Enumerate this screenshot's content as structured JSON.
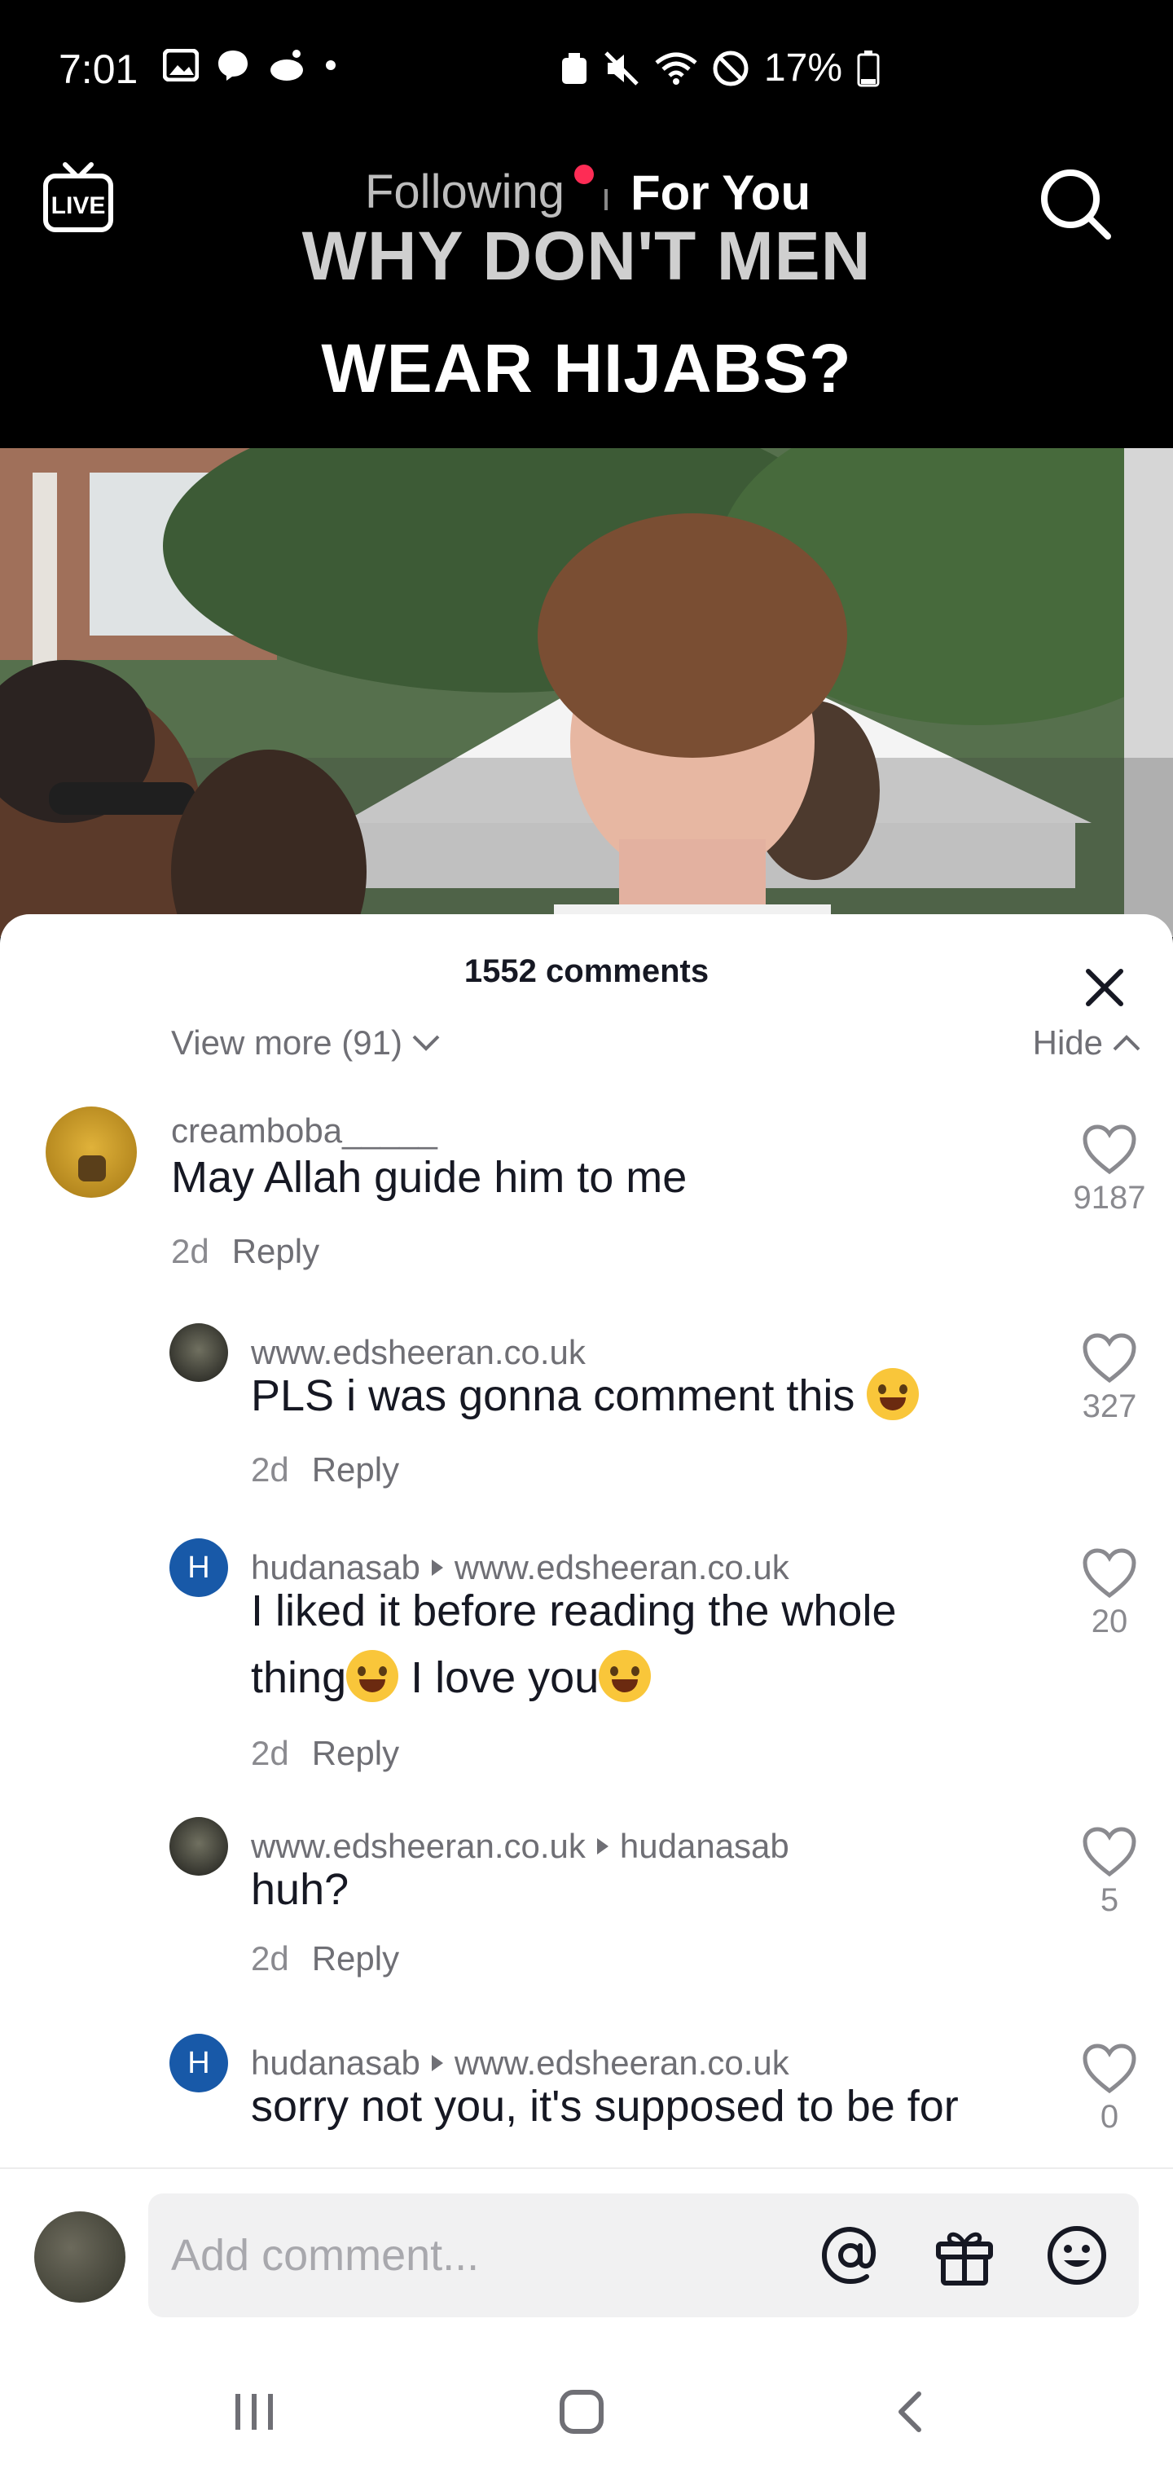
{
  "status_bar": {
    "time": "7:01",
    "battery": "17%"
  },
  "top_nav": {
    "tab_following": "Following",
    "tab_for_you": "For You",
    "live_label": "LIVE"
  },
  "video": {
    "caption_line1": "WHY DON'T MEN",
    "caption_line2": "WEAR HIJABS?"
  },
  "comments_sheet": {
    "count_label": "1552 comments",
    "view_more": "View more (91)",
    "hide": "Hide",
    "comments": [
      {
        "user": "creamboba_____",
        "text": "May Allah guide him to me",
        "time": "2d",
        "reply": "Reply",
        "likes": "9187"
      },
      {
        "user": "www.edsheeran.co.uk",
        "text": "PLS i was gonna comment this",
        "time": "2d",
        "reply": "Reply",
        "likes": "327"
      },
      {
        "user": "hudanasab",
        "reply_to": "www.edsheeran.co.uk",
        "avatar_letter": "H",
        "text_line1": "I liked it before reading the whole",
        "text_line2_a": "thing",
        "text_line2_b": " I love you",
        "time": "2d",
        "reply": "Reply",
        "likes": "20"
      },
      {
        "user": "www.edsheeran.co.uk",
        "reply_to": "hudanasab",
        "text": "huh?",
        "time": "2d",
        "reply": "Reply",
        "likes": "5"
      },
      {
        "user": "hudanasab",
        "reply_to": "www.edsheeran.co.uk",
        "avatar_letter": "H",
        "text": "sorry not you, it's supposed to be for",
        "likes": "0"
      }
    ]
  },
  "input_bar": {
    "placeholder": "Add comment..."
  },
  "icons": {
    "mention": "at-icon",
    "gift": "gift-icon",
    "emoji": "smiley-icon"
  }
}
